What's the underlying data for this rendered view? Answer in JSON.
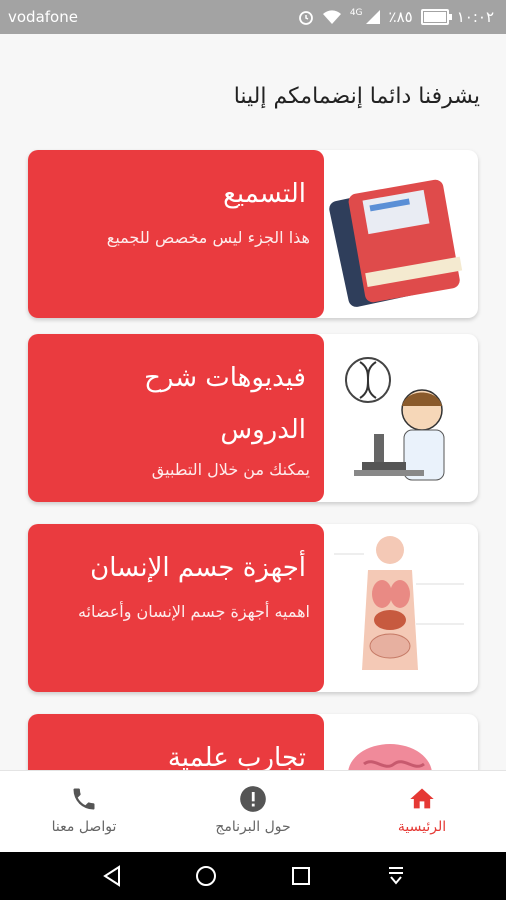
{
  "status_bar": {
    "carrier": "vodafone",
    "time": "١٠:٠٢",
    "battery": "٪٨٥",
    "network": "4G"
  },
  "welcome_text": "يشرفنا دائما إنضمامكم إلينا",
  "cards": [
    {
      "title": "التسميع",
      "description": "هذا الجزء ليس مخصص للجميع",
      "icon": "book-icon"
    },
    {
      "title_line1": "فيديوهات شرح",
      "title_line2": "الدروس",
      "description": "يمكنك من خلال التطبيق",
      "icon": "scientist-microscope-icon"
    },
    {
      "title": "أجهزة جسم الإنسان",
      "description": "اهميه أجهزة جسم الإنسان وأعضائه",
      "icon": "human-organs-icon"
    },
    {
      "title": "تجارب علمية",
      "icon": "brain-icon"
    }
  ],
  "bottom_nav": [
    {
      "label": "تواصل معنا",
      "icon": "phone-icon",
      "active": false
    },
    {
      "label": "حول البرنامج",
      "icon": "info-icon",
      "active": false
    },
    {
      "label": "الرئيسية",
      "icon": "home-icon",
      "active": true
    }
  ],
  "colors": {
    "accent": "#ea3b3f",
    "nav_active": "#e53935",
    "status_bar": "#a3a3a3"
  }
}
